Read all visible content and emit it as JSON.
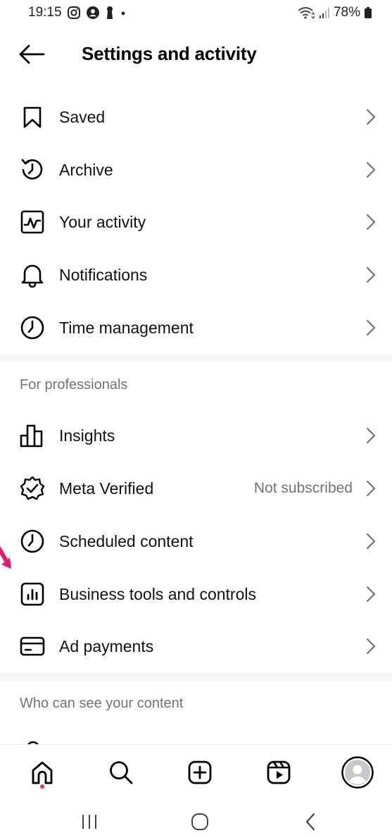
{
  "status_bar": {
    "time": "19:15",
    "battery": "78%"
  },
  "header": {
    "title": "Settings and activity"
  },
  "menu_top": [
    {
      "label": "Saved",
      "icon": "bookmark-icon"
    },
    {
      "label": "Archive",
      "icon": "archive-icon"
    },
    {
      "label": "Your activity",
      "icon": "activity-icon"
    },
    {
      "label": "Notifications",
      "icon": "bell-icon"
    },
    {
      "label": "Time management",
      "icon": "clock-icon"
    }
  ],
  "sections": {
    "professionals": "For professionals",
    "visibility": "Who can see your content"
  },
  "menu_pro": [
    {
      "label": "Insights",
      "icon": "bar-chart-icon"
    },
    {
      "label": "Meta Verified",
      "icon": "verified-badge-icon",
      "value": "Not subscribed"
    },
    {
      "label": "Scheduled content",
      "icon": "clock-icon"
    },
    {
      "label": "Business tools and controls",
      "icon": "business-tools-icon"
    },
    {
      "label": "Ad payments",
      "icon": "credit-card-icon"
    }
  ],
  "bottom_nav": [
    "home-icon",
    "search-icon",
    "create-icon",
    "reels-icon",
    "profile-avatar"
  ],
  "colors": {
    "text": "#111111",
    "secondary": "#737373",
    "divider": "#f7f7f8",
    "notification_dot": "#ff3040",
    "annotation_arrow": "#e8186f"
  }
}
